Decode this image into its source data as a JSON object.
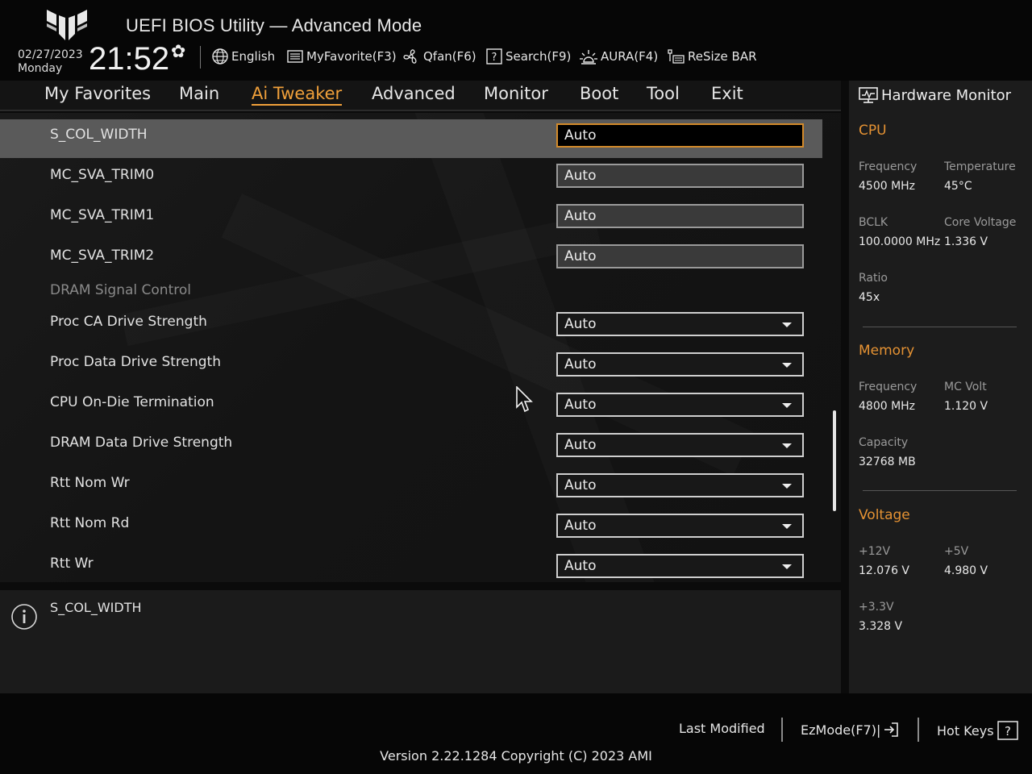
{
  "header": {
    "title": "UEFI BIOS Utility — Advanced Mode",
    "date": "02/27/2023",
    "day": "Monday",
    "time": "21:52",
    "tools": [
      {
        "label": "English",
        "icon": "globe-icon"
      },
      {
        "label": "MyFavorite(F3)",
        "icon": "favorite-list-icon"
      },
      {
        "label": "Qfan(F6)",
        "icon": "fan-icon"
      },
      {
        "label": "Search(F9)",
        "icon": "search-help-icon"
      },
      {
        "label": "AURA(F4)",
        "icon": "aura-light-icon"
      },
      {
        "label": "ReSize BAR",
        "icon": "resize-bar-icon"
      }
    ]
  },
  "nav": {
    "tabs": [
      "My Favorites",
      "Main",
      "Ai Tweaker",
      "Advanced",
      "Monitor",
      "Boot",
      "Tool",
      "Exit"
    ],
    "active": "Ai Tweaker"
  },
  "settings": [
    {
      "label": "S_COL_WIDTH",
      "value": "Auto",
      "kind": "input",
      "selected": true
    },
    {
      "label": "MC_SVA_TRIM0",
      "value": "Auto",
      "kind": "input"
    },
    {
      "label": "MC_SVA_TRIM1",
      "value": "Auto",
      "kind": "input"
    },
    {
      "label": "MC_SVA_TRIM2",
      "value": "Auto",
      "kind": "input"
    },
    {
      "label": "DRAM Signal Control",
      "kind": "section"
    },
    {
      "label": "Proc CA Drive Strength",
      "value": "Auto",
      "kind": "dropdown"
    },
    {
      "label": "Proc Data Drive Strength",
      "value": "Auto",
      "kind": "dropdown"
    },
    {
      "label": "CPU On-Die Termination",
      "value": "Auto",
      "kind": "dropdown"
    },
    {
      "label": "DRAM Data Drive Strength",
      "value": "Auto",
      "kind": "dropdown"
    },
    {
      "label": "Rtt Nom Wr",
      "value": "Auto",
      "kind": "dropdown"
    },
    {
      "label": "Rtt Nom Rd",
      "value": "Auto",
      "kind": "dropdown"
    },
    {
      "label": "Rtt Wr",
      "value": "Auto",
      "kind": "dropdown"
    }
  ],
  "help": {
    "text": "S_COL_WIDTH"
  },
  "hardware_monitor": {
    "title": "Hardware Monitor",
    "cpu": {
      "title": "CPU",
      "frequency_label": "Frequency",
      "frequency": "4500 MHz",
      "temperature_label": "Temperature",
      "temperature": "45°C",
      "bclk_label": "BCLK",
      "bclk": "100.0000 MHz",
      "core_voltage_label": "Core Voltage",
      "core_voltage": "1.336 V",
      "ratio_label": "Ratio",
      "ratio": "45x"
    },
    "memory": {
      "title": "Memory",
      "frequency_label": "Frequency",
      "frequency": "4800 MHz",
      "mc_volt_label": "MC Volt",
      "mc_volt": "1.120 V",
      "capacity_label": "Capacity",
      "capacity": "32768 MB"
    },
    "voltage": {
      "title": "Voltage",
      "v12_label": "+12V",
      "v12": "12.076 V",
      "v5_label": "+5V",
      "v5": "4.980 V",
      "v33_label": "+3.3V",
      "v33": "3.328 V"
    }
  },
  "footer": {
    "last_modified": "Last Modified",
    "ezmode": "EzMode(F7)|",
    "hotkeys": "Hot Keys",
    "version": "Version 2.22.1284 Copyright (C) 2023 AMI"
  },
  "colors": {
    "accent": "#f0a03a",
    "section_title": "#e59233",
    "selected_row": "#5a5a5a"
  }
}
